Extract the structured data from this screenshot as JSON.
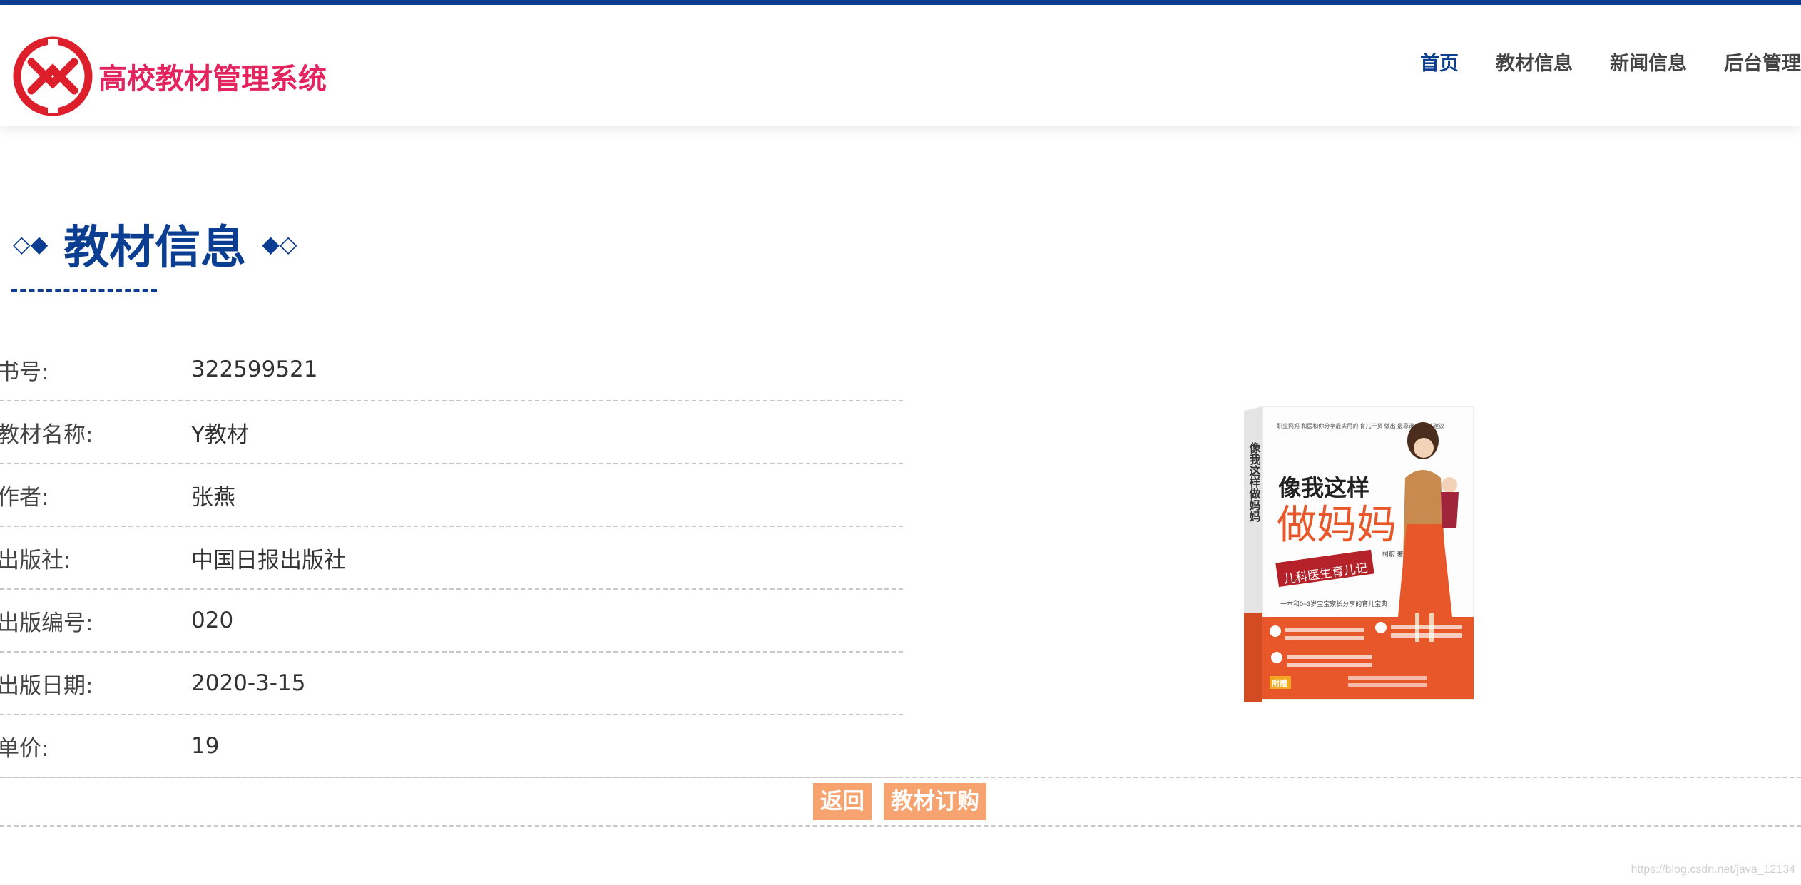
{
  "header": {
    "site_title": "高校教材管理系统",
    "logo_icon": "knot-logo-icon",
    "brand_color": "#e3245e",
    "accent_color": "#0b3d91",
    "nav": [
      {
        "label": "首页",
        "active": true
      },
      {
        "label": "教材信息",
        "active": false
      },
      {
        "label": "新闻信息",
        "active": false
      },
      {
        "label": "后台管理",
        "active": false
      }
    ]
  },
  "section": {
    "title": "教材信息",
    "deco_left": "◇◆",
    "deco_right": "◆◇"
  },
  "details": [
    {
      "label": "书号:",
      "value": "322599521"
    },
    {
      "label": "教材名称:",
      "value": "Y教材"
    },
    {
      "label": "作者:",
      "value": "张燕"
    },
    {
      "label": "出版社:",
      "value": "中国日报出版社"
    },
    {
      "label": "出版编号:",
      "value": "020"
    },
    {
      "label": "出版日期:",
      "value": "2020-3-15"
    },
    {
      "label": "单价:",
      "value": "19"
    }
  ],
  "book_cover": {
    "spine_title": "像我这样做妈妈",
    "line1": "像我这样",
    "line2": "做妈妈",
    "badge": "儿科医生育儿记",
    "tag": "一本和0~3岁宝宝家长分享的育儿宝典",
    "side_text": "职业妈妈 和医和你分享最实用的 育儿干货 做出 最靠谱 的育儿建议",
    "author": "柯蔚 著",
    "gift": "附赠",
    "cover_color": "#e8572a"
  },
  "actions": {
    "back_label": "返回",
    "order_label": "教材订购",
    "button_color": "#f7a36f"
  },
  "watermark": "https://blog.csdn.net/java_12134"
}
